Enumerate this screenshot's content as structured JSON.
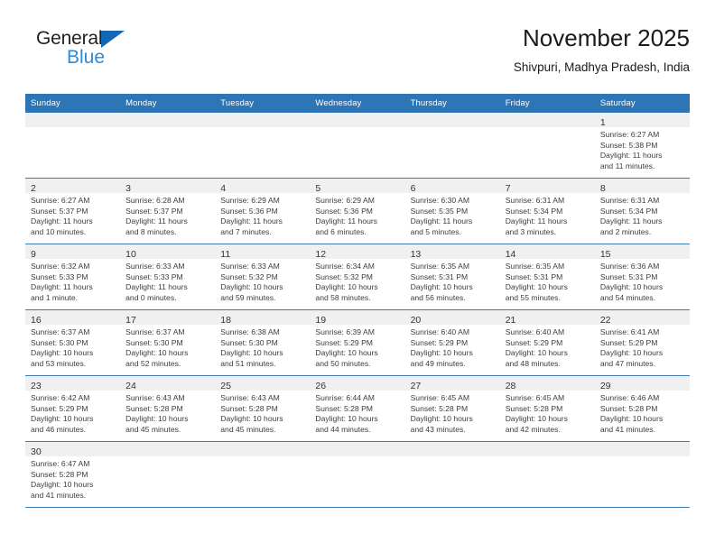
{
  "brand": {
    "name_top": "General",
    "name_bottom": "Blue",
    "triangle_color": "#1268b3",
    "blue_text_color": "#2e8ad6"
  },
  "header": {
    "title": "November 2025",
    "subtitle": "Shivpuri, Madhya Pradesh, India"
  },
  "colors": {
    "header_blue": "#2E75B6",
    "row_divider_blue": "#3F7CB5",
    "daynum_band_gray": "#F0F0F0"
  },
  "weekday_headers": [
    "Sunday",
    "Monday",
    "Tuesday",
    "Wednesday",
    "Thursday",
    "Friday",
    "Saturday"
  ],
  "weeks": [
    [
      {
        "day": "",
        "empty": true,
        "sunrise": "",
        "sunset": "",
        "daylight_line1": "",
        "daylight_line2": ""
      },
      {
        "day": "",
        "empty": true,
        "sunrise": "",
        "sunset": "",
        "daylight_line1": "",
        "daylight_line2": ""
      },
      {
        "day": "",
        "empty": true,
        "sunrise": "",
        "sunset": "",
        "daylight_line1": "",
        "daylight_line2": ""
      },
      {
        "day": "",
        "empty": true,
        "sunrise": "",
        "sunset": "",
        "daylight_line1": "",
        "daylight_line2": ""
      },
      {
        "day": "",
        "empty": true,
        "sunrise": "",
        "sunset": "",
        "daylight_line1": "",
        "daylight_line2": ""
      },
      {
        "day": "",
        "empty": true,
        "sunrise": "",
        "sunset": "",
        "daylight_line1": "",
        "daylight_line2": ""
      },
      {
        "day": "1",
        "empty": false,
        "sunrise": "Sunrise: 6:27 AM",
        "sunset": "Sunset: 5:38 PM",
        "daylight_line1": "Daylight: 11 hours",
        "daylight_line2": "and 11 minutes."
      }
    ],
    [
      {
        "day": "2",
        "empty": false,
        "sunrise": "Sunrise: 6:27 AM",
        "sunset": "Sunset: 5:37 PM",
        "daylight_line1": "Daylight: 11 hours",
        "daylight_line2": "and 10 minutes."
      },
      {
        "day": "3",
        "empty": false,
        "sunrise": "Sunrise: 6:28 AM",
        "sunset": "Sunset: 5:37 PM",
        "daylight_line1": "Daylight: 11 hours",
        "daylight_line2": "and 8 minutes."
      },
      {
        "day": "4",
        "empty": false,
        "sunrise": "Sunrise: 6:29 AM",
        "sunset": "Sunset: 5:36 PM",
        "daylight_line1": "Daylight: 11 hours",
        "daylight_line2": "and 7 minutes."
      },
      {
        "day": "5",
        "empty": false,
        "sunrise": "Sunrise: 6:29 AM",
        "sunset": "Sunset: 5:36 PM",
        "daylight_line1": "Daylight: 11 hours",
        "daylight_line2": "and 6 minutes."
      },
      {
        "day": "6",
        "empty": false,
        "sunrise": "Sunrise: 6:30 AM",
        "sunset": "Sunset: 5:35 PM",
        "daylight_line1": "Daylight: 11 hours",
        "daylight_line2": "and 5 minutes."
      },
      {
        "day": "7",
        "empty": false,
        "sunrise": "Sunrise: 6:31 AM",
        "sunset": "Sunset: 5:34 PM",
        "daylight_line1": "Daylight: 11 hours",
        "daylight_line2": "and 3 minutes."
      },
      {
        "day": "8",
        "empty": false,
        "sunrise": "Sunrise: 6:31 AM",
        "sunset": "Sunset: 5:34 PM",
        "daylight_line1": "Daylight: 11 hours",
        "daylight_line2": "and 2 minutes."
      }
    ],
    [
      {
        "day": "9",
        "empty": false,
        "sunrise": "Sunrise: 6:32 AM",
        "sunset": "Sunset: 5:33 PM",
        "daylight_line1": "Daylight: 11 hours",
        "daylight_line2": "and 1 minute."
      },
      {
        "day": "10",
        "empty": false,
        "sunrise": "Sunrise: 6:33 AM",
        "sunset": "Sunset: 5:33 PM",
        "daylight_line1": "Daylight: 11 hours",
        "daylight_line2": "and 0 minutes."
      },
      {
        "day": "11",
        "empty": false,
        "sunrise": "Sunrise: 6:33 AM",
        "sunset": "Sunset: 5:32 PM",
        "daylight_line1": "Daylight: 10 hours",
        "daylight_line2": "and 59 minutes."
      },
      {
        "day": "12",
        "empty": false,
        "sunrise": "Sunrise: 6:34 AM",
        "sunset": "Sunset: 5:32 PM",
        "daylight_line1": "Daylight: 10 hours",
        "daylight_line2": "and 58 minutes."
      },
      {
        "day": "13",
        "empty": false,
        "sunrise": "Sunrise: 6:35 AM",
        "sunset": "Sunset: 5:31 PM",
        "daylight_line1": "Daylight: 10 hours",
        "daylight_line2": "and 56 minutes."
      },
      {
        "day": "14",
        "empty": false,
        "sunrise": "Sunrise: 6:35 AM",
        "sunset": "Sunset: 5:31 PM",
        "daylight_line1": "Daylight: 10 hours",
        "daylight_line2": "and 55 minutes."
      },
      {
        "day": "15",
        "empty": false,
        "sunrise": "Sunrise: 6:36 AM",
        "sunset": "Sunset: 5:31 PM",
        "daylight_line1": "Daylight: 10 hours",
        "daylight_line2": "and 54 minutes."
      }
    ],
    [
      {
        "day": "16",
        "empty": false,
        "sunrise": "Sunrise: 6:37 AM",
        "sunset": "Sunset: 5:30 PM",
        "daylight_line1": "Daylight: 10 hours",
        "daylight_line2": "and 53 minutes."
      },
      {
        "day": "17",
        "empty": false,
        "sunrise": "Sunrise: 6:37 AM",
        "sunset": "Sunset: 5:30 PM",
        "daylight_line1": "Daylight: 10 hours",
        "daylight_line2": "and 52 minutes."
      },
      {
        "day": "18",
        "empty": false,
        "sunrise": "Sunrise: 6:38 AM",
        "sunset": "Sunset: 5:30 PM",
        "daylight_line1": "Daylight: 10 hours",
        "daylight_line2": "and 51 minutes."
      },
      {
        "day": "19",
        "empty": false,
        "sunrise": "Sunrise: 6:39 AM",
        "sunset": "Sunset: 5:29 PM",
        "daylight_line1": "Daylight: 10 hours",
        "daylight_line2": "and 50 minutes."
      },
      {
        "day": "20",
        "empty": false,
        "sunrise": "Sunrise: 6:40 AM",
        "sunset": "Sunset: 5:29 PM",
        "daylight_line1": "Daylight: 10 hours",
        "daylight_line2": "and 49 minutes."
      },
      {
        "day": "21",
        "empty": false,
        "sunrise": "Sunrise: 6:40 AM",
        "sunset": "Sunset: 5:29 PM",
        "daylight_line1": "Daylight: 10 hours",
        "daylight_line2": "and 48 minutes."
      },
      {
        "day": "22",
        "empty": false,
        "sunrise": "Sunrise: 6:41 AM",
        "sunset": "Sunset: 5:29 PM",
        "daylight_line1": "Daylight: 10 hours",
        "daylight_line2": "and 47 minutes."
      }
    ],
    [
      {
        "day": "23",
        "empty": false,
        "sunrise": "Sunrise: 6:42 AM",
        "sunset": "Sunset: 5:29 PM",
        "daylight_line1": "Daylight: 10 hours",
        "daylight_line2": "and 46 minutes."
      },
      {
        "day": "24",
        "empty": false,
        "sunrise": "Sunrise: 6:43 AM",
        "sunset": "Sunset: 5:28 PM",
        "daylight_line1": "Daylight: 10 hours",
        "daylight_line2": "and 45 minutes."
      },
      {
        "day": "25",
        "empty": false,
        "sunrise": "Sunrise: 6:43 AM",
        "sunset": "Sunset: 5:28 PM",
        "daylight_line1": "Daylight: 10 hours",
        "daylight_line2": "and 45 minutes."
      },
      {
        "day": "26",
        "empty": false,
        "sunrise": "Sunrise: 6:44 AM",
        "sunset": "Sunset: 5:28 PM",
        "daylight_line1": "Daylight: 10 hours",
        "daylight_line2": "and 44 minutes."
      },
      {
        "day": "27",
        "empty": false,
        "sunrise": "Sunrise: 6:45 AM",
        "sunset": "Sunset: 5:28 PM",
        "daylight_line1": "Daylight: 10 hours",
        "daylight_line2": "and 43 minutes."
      },
      {
        "day": "28",
        "empty": false,
        "sunrise": "Sunrise: 6:45 AM",
        "sunset": "Sunset: 5:28 PM",
        "daylight_line1": "Daylight: 10 hours",
        "daylight_line2": "and 42 minutes."
      },
      {
        "day": "29",
        "empty": false,
        "sunrise": "Sunrise: 6:46 AM",
        "sunset": "Sunset: 5:28 PM",
        "daylight_line1": "Daylight: 10 hours",
        "daylight_line2": "and 41 minutes."
      }
    ],
    [
      {
        "day": "30",
        "empty": false,
        "sunrise": "Sunrise: 6:47 AM",
        "sunset": "Sunset: 5:28 PM",
        "daylight_line1": "Daylight: 10 hours",
        "daylight_line2": "and 41 minutes."
      },
      {
        "day": "",
        "empty": true,
        "sunrise": "",
        "sunset": "",
        "daylight_line1": "",
        "daylight_line2": ""
      },
      {
        "day": "",
        "empty": true,
        "sunrise": "",
        "sunset": "",
        "daylight_line1": "",
        "daylight_line2": ""
      },
      {
        "day": "",
        "empty": true,
        "sunrise": "",
        "sunset": "",
        "daylight_line1": "",
        "daylight_line2": ""
      },
      {
        "day": "",
        "empty": true,
        "sunrise": "",
        "sunset": "",
        "daylight_line1": "",
        "daylight_line2": ""
      },
      {
        "day": "",
        "empty": true,
        "sunrise": "",
        "sunset": "",
        "daylight_line1": "",
        "daylight_line2": ""
      },
      {
        "day": "",
        "empty": true,
        "sunrise": "",
        "sunset": "",
        "daylight_line1": "",
        "daylight_line2": ""
      }
    ]
  ]
}
